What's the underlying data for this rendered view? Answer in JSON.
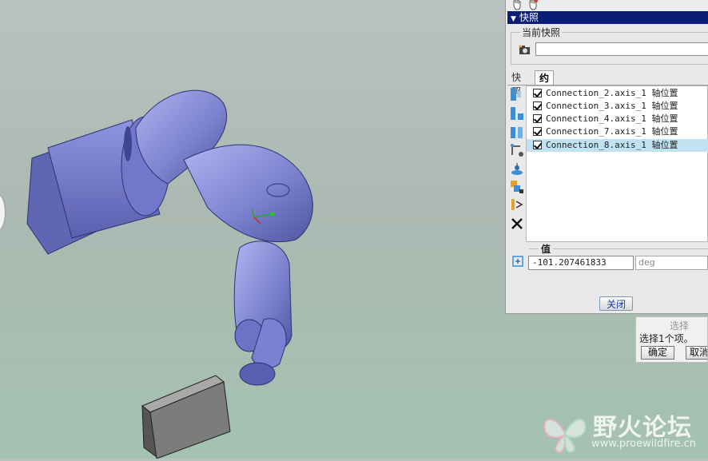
{
  "panel": {
    "title": "快照",
    "current_snapshot_label": "当前快照",
    "snapshot_name_value": "",
    "tabs": [
      {
        "label": "快照",
        "active": false
      },
      {
        "label": "约束",
        "active": true
      }
    ],
    "constraints": [
      {
        "label": "Connection_2.axis_1 轴位置",
        "checked": true,
        "selected": false
      },
      {
        "label": "Connection_3.axis_1 轴位置",
        "checked": true,
        "selected": false
      },
      {
        "label": "Connection_4.axis_1 轴位置",
        "checked": true,
        "selected": false
      },
      {
        "label": "Connection_7.axis_1 轴位置",
        "checked": true,
        "selected": false
      },
      {
        "label": "Connection_8.axis_1 轴位置",
        "checked": true,
        "selected": true
      }
    ],
    "value_label": "值",
    "value": "-101.207461833",
    "unit": "deg",
    "close_label": "关闭",
    "accent_color": "#0a1e78",
    "selection_color": "#bfe3f3"
  },
  "select_dialog": {
    "title": "选择",
    "hint": "选择1个项。",
    "ok_label": "确定",
    "cancel_label": "取消"
  },
  "watermark": {
    "title": "野火论坛",
    "url": "www.proewildfire.cn"
  },
  "icons": {
    "toolbar": [
      "hand-icon",
      "hand-icon-alt"
    ],
    "camera": "camera-icon",
    "tools": [
      "align-icon",
      "mate-icon",
      "parallel-icon",
      "drag-point-icon",
      "gravity-icon",
      "lock-icon",
      "motion-icon",
      "delete-icon"
    ],
    "value": "value-icon"
  }
}
